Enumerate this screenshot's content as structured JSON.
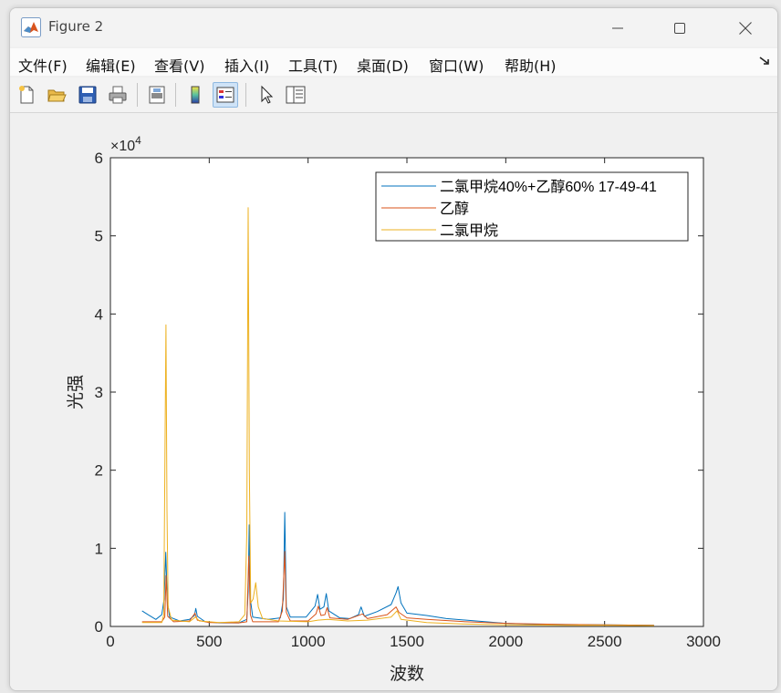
{
  "window": {
    "title": "Figure 2",
    "controls": {
      "minimize": "—",
      "maximize": "☐",
      "close": "✕"
    }
  },
  "menu": [
    {
      "label": "文件(F)"
    },
    {
      "label": "编辑(E)"
    },
    {
      "label": "查看(V)"
    },
    {
      "label": "插入(I)"
    },
    {
      "label": "工具(T)"
    },
    {
      "label": "桌面(D)"
    },
    {
      "label": "窗口(W)"
    },
    {
      "label": "帮助(H)"
    }
  ],
  "toolbar": [
    {
      "icon": "new-figure-icon"
    },
    {
      "icon": "open-file-icon"
    },
    {
      "icon": "save-icon"
    },
    {
      "icon": "print-icon"
    },
    {
      "icon": "print-preview-icon"
    },
    {
      "icon": "colorbar-icon"
    },
    {
      "icon": "legend-icon",
      "active": true
    },
    {
      "icon": "select-pointer-icon"
    },
    {
      "icon": "property-inspector-icon"
    }
  ],
  "chart_data": {
    "type": "line",
    "xlabel": "波数",
    "ylabel": "光强",
    "exponent_label": "×10",
    "exponent_power": "4",
    "xlim": [
      0,
      3000
    ],
    "ylim": [
      0,
      60000
    ],
    "xticks": [
      0,
      500,
      1000,
      1500,
      2000,
      2500,
      3000
    ],
    "yticks": [
      0,
      1,
      2,
      3,
      4,
      5,
      6
    ],
    "legend_position": "top-right",
    "grid": false,
    "series": [
      {
        "name": "二氯甲烷40%+乙醇60% 17-49-41",
        "color": "#0072BD",
        "points": [
          [
            160,
            2000
          ],
          [
            190,
            1500
          ],
          [
            230,
            900
          ],
          [
            260,
            1500
          ],
          [
            272,
            3500
          ],
          [
            280,
            9500
          ],
          [
            288,
            3200
          ],
          [
            300,
            1200
          ],
          [
            350,
            700
          ],
          [
            400,
            900
          ],
          [
            425,
            1400
          ],
          [
            432,
            2300
          ],
          [
            440,
            1300
          ],
          [
            480,
            600
          ],
          [
            550,
            450
          ],
          [
            650,
            450
          ],
          [
            690,
            900
          ],
          [
            697,
            4500
          ],
          [
            702,
            13000
          ],
          [
            708,
            3500
          ],
          [
            720,
            1200
          ],
          [
            800,
            900
          ],
          [
            860,
            1100
          ],
          [
            875,
            3500
          ],
          [
            882,
            14600
          ],
          [
            890,
            2500
          ],
          [
            910,
            1200
          ],
          [
            990,
            1200
          ],
          [
            1035,
            2600
          ],
          [
            1048,
            4100
          ],
          [
            1060,
            2200
          ],
          [
            1080,
            2500
          ],
          [
            1092,
            4200
          ],
          [
            1105,
            2000
          ],
          [
            1160,
            1100
          ],
          [
            1210,
            1000
          ],
          [
            1255,
            1500
          ],
          [
            1268,
            2500
          ],
          [
            1285,
            1300
          ],
          [
            1350,
            1900
          ],
          [
            1420,
            2800
          ],
          [
            1445,
            4300
          ],
          [
            1455,
            5100
          ],
          [
            1470,
            3000
          ],
          [
            1500,
            1700
          ],
          [
            1600,
            1400
          ],
          [
            1700,
            1000
          ],
          [
            1800,
            800
          ],
          [
            1900,
            600
          ],
          [
            2000,
            400
          ],
          [
            2100,
            300
          ],
          [
            2300,
            250
          ],
          [
            2500,
            200
          ],
          [
            2750,
            150
          ]
        ]
      },
      {
        "name": "乙醇",
        "color": "#D95319",
        "points": [
          [
            160,
            600
          ],
          [
            260,
            600
          ],
          [
            275,
            1200
          ],
          [
            282,
            6500
          ],
          [
            290,
            1300
          ],
          [
            320,
            600
          ],
          [
            400,
            700
          ],
          [
            428,
            1700
          ],
          [
            440,
            800
          ],
          [
            500,
            500
          ],
          [
            650,
            450
          ],
          [
            690,
            600
          ],
          [
            700,
            9000
          ],
          [
            708,
            1500
          ],
          [
            720,
            600
          ],
          [
            850,
            600
          ],
          [
            870,
            2000
          ],
          [
            882,
            9600
          ],
          [
            890,
            1800
          ],
          [
            910,
            700
          ],
          [
            1000,
            700
          ],
          [
            1040,
            1600
          ],
          [
            1052,
            2600
          ],
          [
            1065,
            1400
          ],
          [
            1085,
            1500
          ],
          [
            1096,
            2400
          ],
          [
            1110,
            1100
          ],
          [
            1200,
            900
          ],
          [
            1275,
            1600
          ],
          [
            1300,
            1000
          ],
          [
            1400,
            1500
          ],
          [
            1445,
            2500
          ],
          [
            1460,
            1800
          ],
          [
            1500,
            1100
          ],
          [
            1600,
            900
          ],
          [
            1800,
            600
          ],
          [
            2000,
            400
          ],
          [
            2300,
            250
          ],
          [
            2500,
            200
          ],
          [
            2750,
            150
          ]
        ]
      },
      {
        "name": "二氯甲烷",
        "color": "#EDB120",
        "points": [
          [
            160,
            500
          ],
          [
            260,
            500
          ],
          [
            270,
            1500
          ],
          [
            276,
            22000
          ],
          [
            281,
            38600
          ],
          [
            286,
            15000
          ],
          [
            292,
            2500
          ],
          [
            310,
            800
          ],
          [
            400,
            600
          ],
          [
            430,
            1200
          ],
          [
            450,
            700
          ],
          [
            550,
            500
          ],
          [
            650,
            600
          ],
          [
            680,
            1500
          ],
          [
            690,
            12000
          ],
          [
            697,
            53600
          ],
          [
            703,
            20000
          ],
          [
            710,
            3000
          ],
          [
            722,
            3500
          ],
          [
            735,
            5600
          ],
          [
            748,
            2500
          ],
          [
            770,
            1000
          ],
          [
            850,
            700
          ],
          [
            1000,
            600
          ],
          [
            1050,
            800
          ],
          [
            1100,
            900
          ],
          [
            1200,
            700
          ],
          [
            1300,
            800
          ],
          [
            1420,
            1200
          ],
          [
            1450,
            2000
          ],
          [
            1470,
            900
          ],
          [
            1600,
            500
          ],
          [
            1800,
            300
          ],
          [
            2000,
            200
          ],
          [
            2300,
            150
          ],
          [
            2500,
            150
          ],
          [
            2750,
            100
          ]
        ]
      }
    ]
  }
}
